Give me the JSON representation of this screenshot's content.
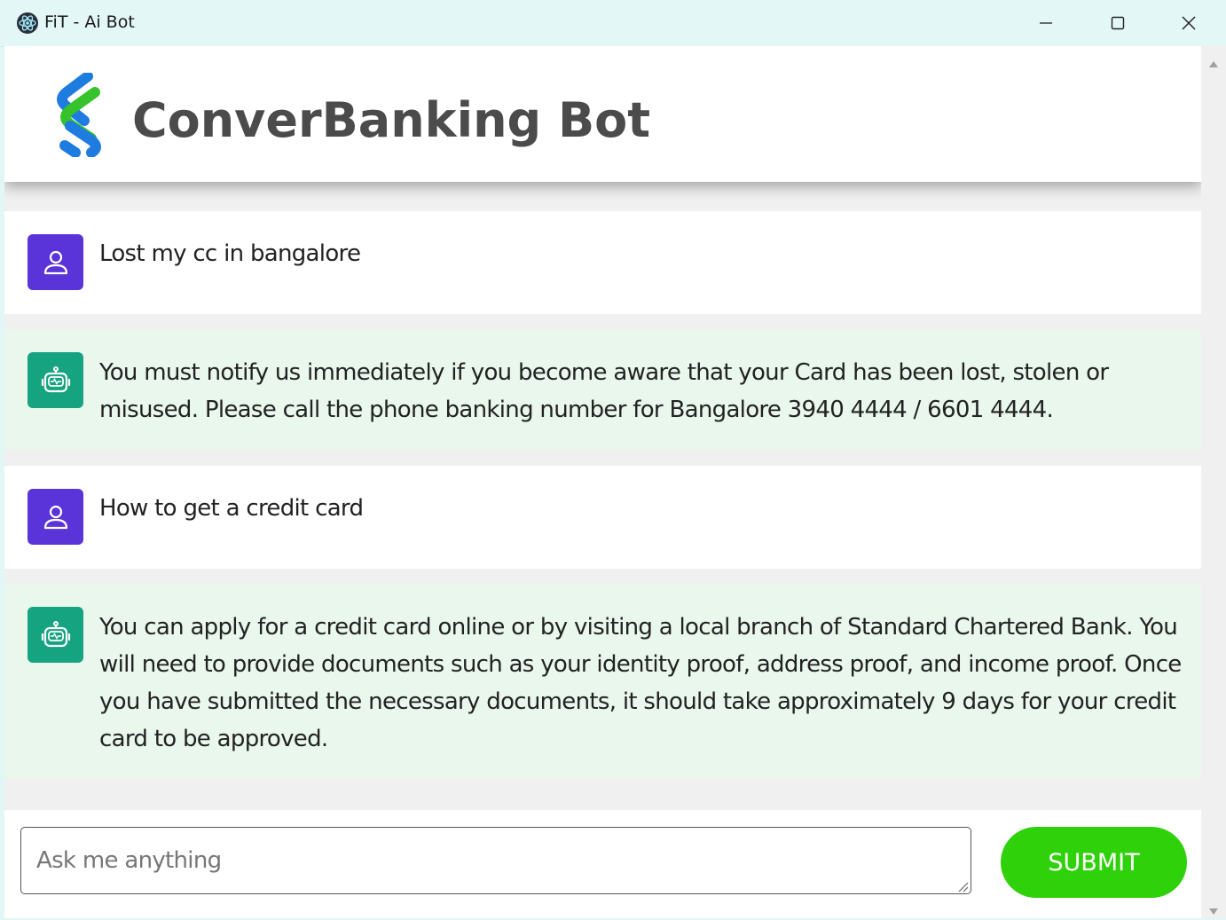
{
  "window": {
    "title": "FiT - Ai Bot",
    "controls": [
      "minimize",
      "maximize",
      "close"
    ]
  },
  "header": {
    "title": "ConverBanking Bot",
    "logo_icon": "bank-logo-icon"
  },
  "colors": {
    "user_avatar": "#5b34d9",
    "bot_avatar": "#16a37f",
    "bot_message_bg": "#e9f7ec",
    "submit_button": "#2fd10a",
    "title_text": "#4b4b4b"
  },
  "messages": [
    {
      "role": "user",
      "icon": "user-icon",
      "text": "Lost my cc in bangalore"
    },
    {
      "role": "bot",
      "icon": "robot-icon",
      "text": " You must notify us immediately if you become aware that your Card has been lost, stolen or misused. Please call the phone banking number for Bangalore 3940 4444 / 6601 4444."
    },
    {
      "role": "user",
      "icon": "user-icon",
      "text": "How to get a credit card"
    },
    {
      "role": "bot",
      "icon": "robot-icon",
      "text": " You can apply for a credit card online or by visiting a local branch of Standard Chartered Bank. You will need to provide documents such as your identity proof, address proof, and income proof. Once you have submitted the necessary documents, it should take approximately 9 days for your credit card to be approved."
    }
  ],
  "input": {
    "placeholder": "Ask me anything",
    "value": ""
  },
  "submit": {
    "label": "SUBMIT"
  }
}
